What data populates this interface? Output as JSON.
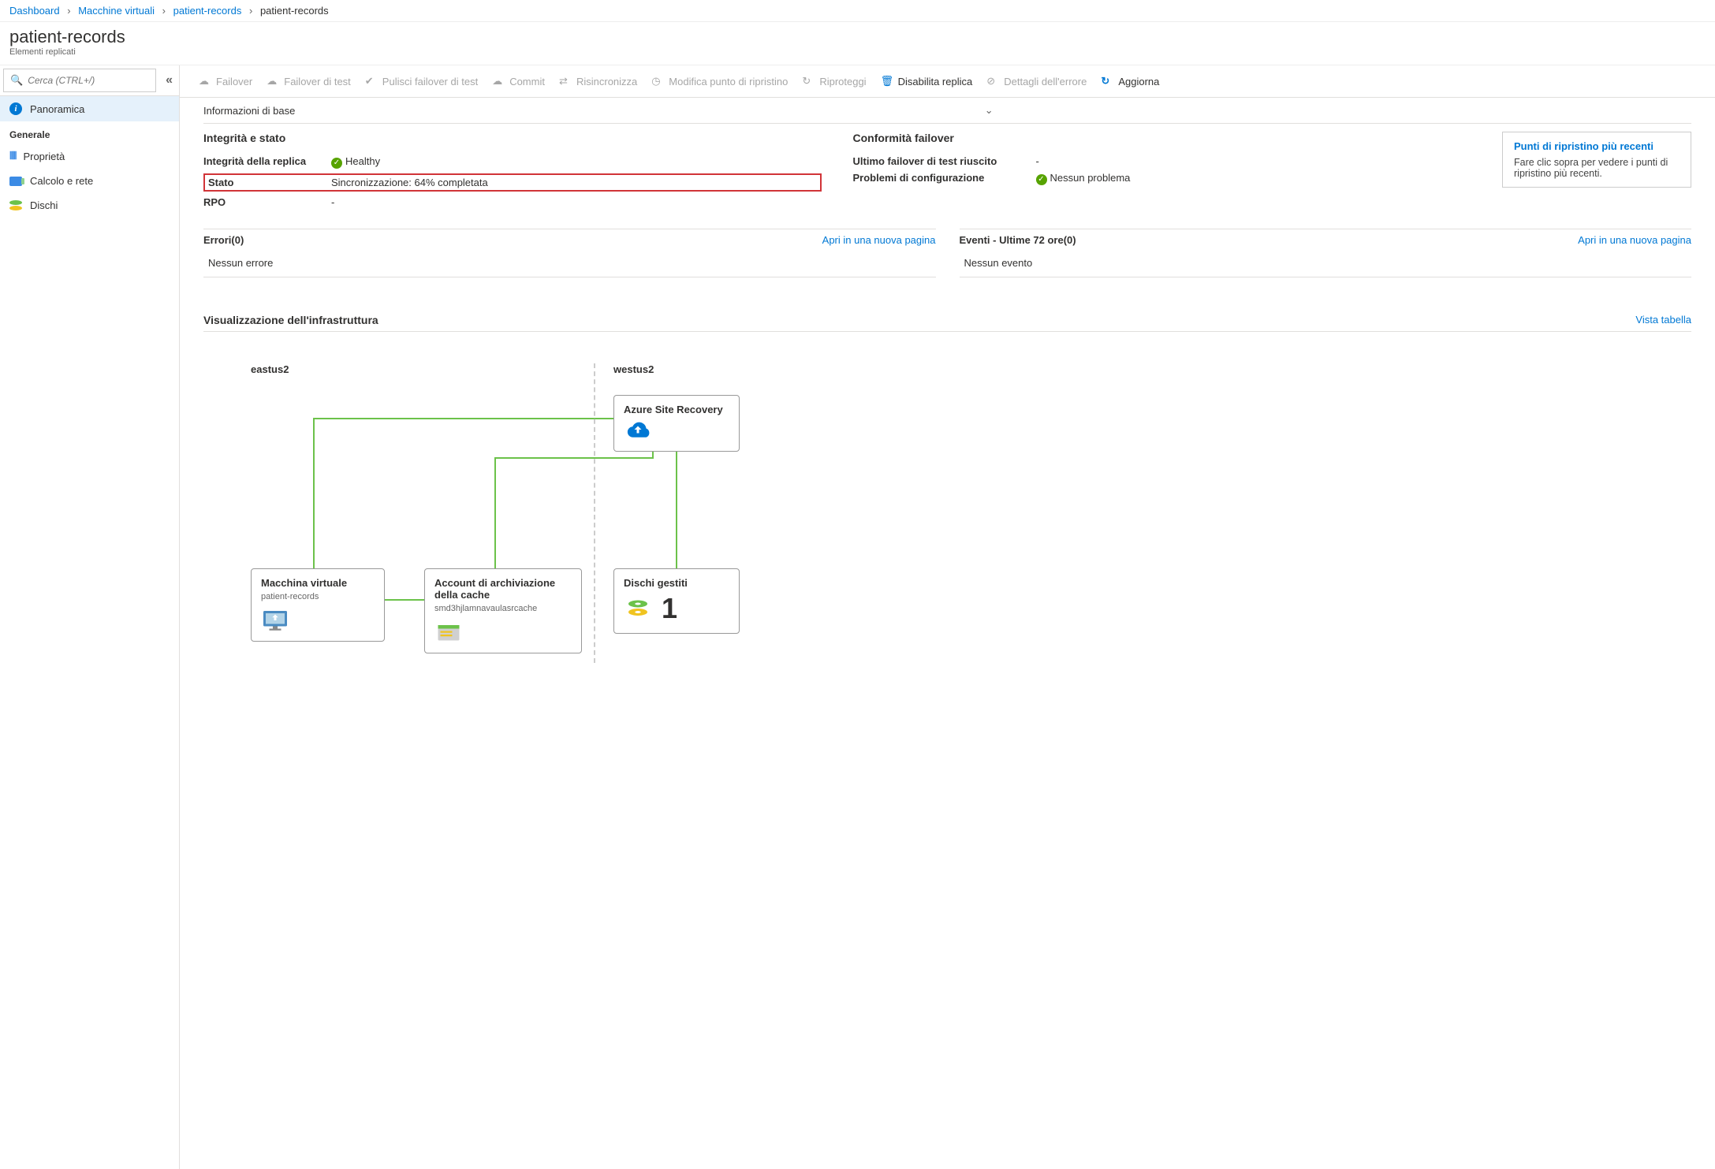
{
  "breadcrumb": {
    "items": [
      "Dashboard",
      "Macchine virtuali",
      "patient-records"
    ],
    "current": "patient-records"
  },
  "page": {
    "title": "patient-records",
    "subtitle": "Elementi replicati"
  },
  "sidebar": {
    "search_placeholder": "Cerca (CTRL+/)",
    "items": {
      "overview": "Panoramica",
      "section_general": "Generale",
      "properties": "Proprietà",
      "compute": "Calcolo e rete",
      "disks": "Dischi"
    }
  },
  "toolbar": {
    "failover": "Failover",
    "test_failover": "Failover di test",
    "cleanup": "Pulisci failover di test",
    "commit": "Commit",
    "resync": "Risincronizza",
    "change_rp": "Modifica punto di ripristino",
    "reprotect": "Riproteggi",
    "disable": "Disabilita replica",
    "error_details": "Dettagli dell'errore",
    "refresh": "Aggiorna"
  },
  "essentials": {
    "header": "Informazioni di base",
    "health": {
      "title": "Integrità e stato",
      "replication_label": "Integrità della replica",
      "replication_value": "Healthy",
      "status_label": "Stato",
      "status_value": "Sincronizzazione: 64% completata",
      "rpo_label": "RPO",
      "rpo_value": "-"
    },
    "failover": {
      "title": "Conformità failover",
      "last_test_label": "Ultimo failover di test riuscito",
      "last_test_value": "-",
      "config_label": "Problemi di configurazione",
      "config_value": "Nessun problema"
    },
    "recovery": {
      "title": "Punti di ripristino più recenti",
      "desc": "Fare clic sopra per vedere i punti di ripristino più recenti."
    }
  },
  "panels": {
    "errors_title": "Errori(0)",
    "errors_body": "Nessun errore",
    "events_title": "Eventi - Ultime 72 ore(0)",
    "events_body": "Nessun evento",
    "open_link": "Apri in una nuova pagina"
  },
  "infra": {
    "title": "Visualizzazione dell'infrastruttura",
    "table_view": "Vista tabella",
    "region_left": "eastus2",
    "region_right": "westus2",
    "nodes": {
      "asr": "Azure Site Recovery",
      "vm_title": "Macchina virtuale",
      "vm_sub": "patient-records",
      "cache_title": "Account di archiviazione della cache",
      "cache_sub": "smd3hjlamnavaulasrcache",
      "disks_title": "Dischi gestiti",
      "disks_count": "1"
    }
  }
}
